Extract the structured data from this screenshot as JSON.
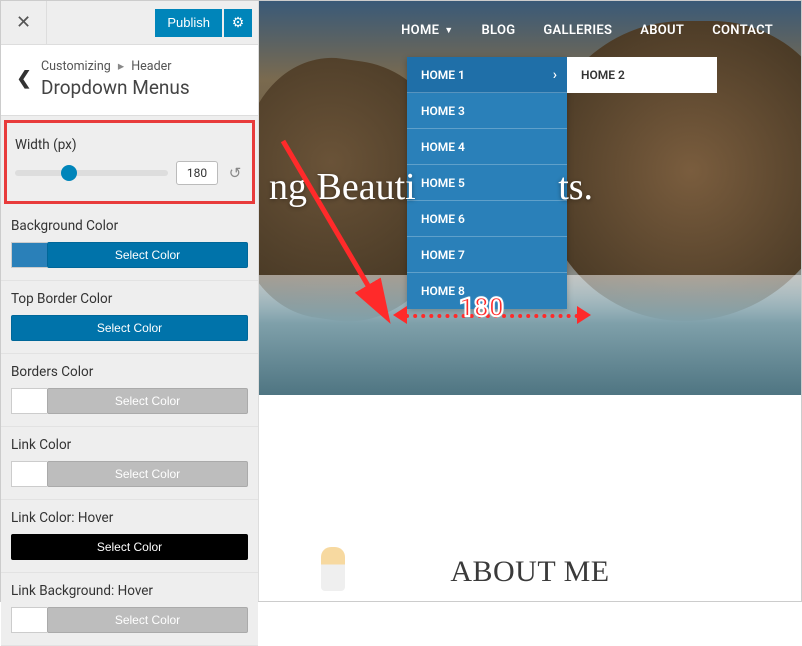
{
  "topbar": {
    "publish": "Publish"
  },
  "breadcrumb": {
    "prefix": "Customizing",
    "parent": "Header",
    "title": "Dropdown Menus"
  },
  "controls": {
    "width": {
      "label": "Width (px)",
      "value": "180",
      "percent": 30
    },
    "bg": {
      "label": "Background Color",
      "btn": "Select Color",
      "swatch": "#2a80b9",
      "style": "blue",
      "full": false
    },
    "topborder": {
      "label": "Top Border Color",
      "btn": "Select Color",
      "swatch": null,
      "style": "blue",
      "full": true
    },
    "borders": {
      "label": "Borders Color",
      "btn": "Select Color",
      "swatch": "#ffffff",
      "style": "grey",
      "full": false
    },
    "link": {
      "label": "Link Color",
      "btn": "Select Color",
      "swatch": "#ffffff",
      "style": "grey",
      "full": false
    },
    "linkhover": {
      "label": "Link Color: Hover",
      "btn": "Select Color",
      "swatch": null,
      "style": "black",
      "full": true
    },
    "linkbg": {
      "label": "Link Background: Hover",
      "btn": "Select Color",
      "swatch": "#ffffff",
      "style": "grey",
      "full": false
    }
  },
  "nav": {
    "items": [
      {
        "label": "HOME",
        "caret": true
      },
      {
        "label": "BLOG"
      },
      {
        "label": "GALLERIES"
      },
      {
        "label": "ABOUT"
      },
      {
        "label": "CONTACT"
      }
    ]
  },
  "dropdown": {
    "items": [
      "HOME 1",
      "HOME 3",
      "HOME 4",
      "HOME 5",
      "HOME 6",
      "HOME 7",
      "HOME 8"
    ],
    "submenu": [
      "HOME 2"
    ]
  },
  "hero": {
    "title_fragment": "ng Beauti               ts."
  },
  "annotation": {
    "width_value": "180"
  },
  "about": {
    "heading": "ABOUT ME"
  }
}
